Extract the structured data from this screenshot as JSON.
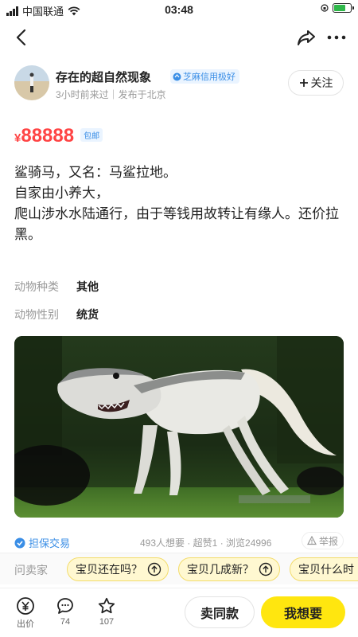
{
  "status_bar": {
    "carrier": "中国联通",
    "time": "03:48"
  },
  "seller": {
    "name": "存在的超自然现象",
    "credit_badge": "芝麻信用极好",
    "meta": "3小时前来过｜发布于北京",
    "follow_label": "关注"
  },
  "price": {
    "symbol": "¥",
    "value": "88888",
    "shipping_tag": "包邮"
  },
  "description": {
    "lines": [
      "鲨骑马，又名：马鲨拉地。",
      "自家由小养大，",
      "爬山涉水水陆通行，由于等钱用故转让有缘人。还价拉黑。"
    ]
  },
  "attributes": [
    {
      "key": "动物种类",
      "value": "其他"
    },
    {
      "key": "动物性别",
      "value": "统货"
    }
  ],
  "stats": {
    "guarantee_label": "担保交易",
    "stats_text": "493人想要 · 超赞1 · 浏览24996",
    "report_label": "举报"
  },
  "ask_bar": {
    "label": "问卖家",
    "chips": [
      "宝贝还在吗？",
      "宝贝几成新？",
      "宝贝什么时"
    ]
  },
  "bottom_bar": {
    "bid_label": "出价",
    "comments_count": "74",
    "favorites_count": "107",
    "same_label": "卖同款",
    "want_label": "我想要"
  },
  "colors": {
    "price": "#ff4444",
    "link_blue": "#3a8ee6",
    "want_button": "#ffe60f",
    "battery": "#2fb84a"
  },
  "icons": {
    "back": "chevron-left-icon",
    "share": "share-arrow-icon",
    "more": "more-dots-icon",
    "bid": "yen-coin-icon",
    "comments": "chat-bubble-icon",
    "favorites": "star-icon"
  }
}
